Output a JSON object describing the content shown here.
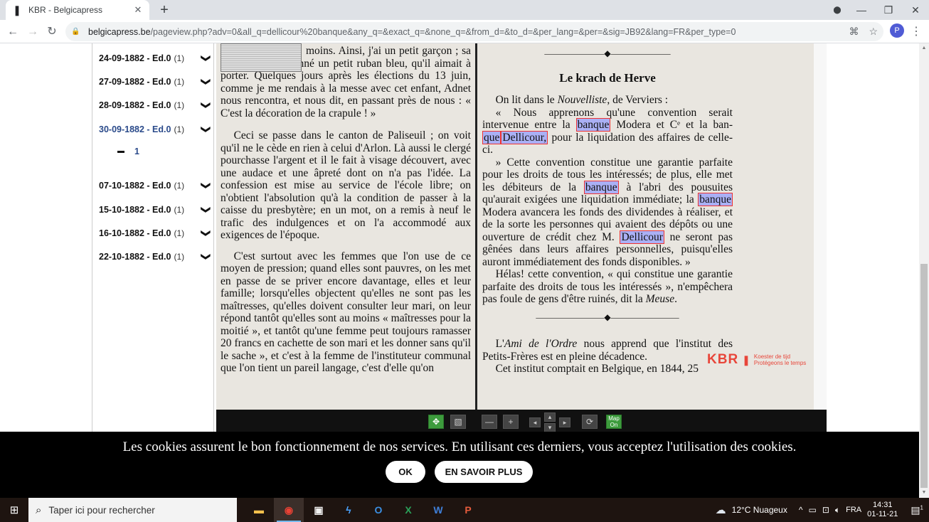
{
  "browser": {
    "tab_title": "KBR - Belgicapress",
    "url_host": "belgicapress.be",
    "url_path": "/pageview.php?adv=0&all_q=dellicour%20banque&any_q=&exact_q=&none_q=&from_d=&to_d=&per_lang=&per=&sig=JB92&lang=FR&per_type=0",
    "profile_initial": "P"
  },
  "sidebar": {
    "editions": [
      {
        "label": "24-09-1882 - Ed.0",
        "count": "(1)"
      },
      {
        "label": "27-09-1882 - Ed.0",
        "count": "(1)"
      },
      {
        "label": "28-09-1882 - Ed.0",
        "count": "(1)"
      },
      {
        "label": "30-09-1882 - Ed.0",
        "count": "(1)"
      },
      {
        "label": "07-10-1882 - Ed.0",
        "count": "(1)"
      },
      {
        "label": "15-10-1882 - Ed.0",
        "count": "(1)"
      },
      {
        "label": "16-10-1882 - Ed.0",
        "count": "(1)"
      },
      {
        "label": "22-10-1882 - Ed.0",
        "count": "(1)"
      }
    ],
    "active_page": "1"
  },
  "newspaper": {
    "left_lines_1": "moins. Ainsi, j'ai un petit garçon ; sa mère lui avait donné un petit ruban bleu, qu'il aimait à porter. Quelques jours après les élections du 13 juin, comme je me rendais à la messe avec cet enfant, Adnet nous rencontra, et nous dit, en passant près de nous : « C'est la décoration de la crapule ! »",
    "left_p2": "Ceci se passe dans le canton de Paliseuil ; on voit qu'il ne le cède en rien à celui d'Arlon. Là aussi le clergé pourchasse l'argent et il le fait à visage découvert, avec une audace et une âpreté dont on n'a pas l'idée. La confession est mise au service de l'école libre; on n'obtient l'absolution qu'à la condition de passer à la caisse du presbytère; en un mot, on a remis à neuf le trafic des indulgences et on l'a accommodé aux exigences de l'époque.",
    "left_p3": "C'est surtout avec les femmes que l'on use de ce moyen de pression; quand elles sont pauvres, on les met en passe de se priver encore davantage, elles et leur famille; lorsqu'elles objectent qu'elles ne sont pas les maîtresses, qu'elles doivent consulter leur mari, on leur répond tantôt qu'elles sont au moins « maîtresses pour la moitié », et tantôt qu'une femme peut toujours ramasser 20 francs en cachette de son mari et les donner sans qu'il le sache », et c'est à la femme de l'instituteur communal que l'on tient un pareil langage, c'est d'elle qu'on",
    "right_title": "Le krach de Herve",
    "right_p1_a": "On lit dans le",
    "right_p1_italic": "Nouvelliste",
    "right_p1_b": ", de Verviers :",
    "right_p2_a": "« Nous apprenons qu'une convention serait intervenue entre la",
    "hl_banque": "banque",
    "right_p2_b": "Modera et Cᵉ et la ban-",
    "hl_que": "que",
    "hl_dellicour_comma": "Dellicour,",
    "right_p2_c": "pour la liquidation des affaires de celle-ci.",
    "right_p3_a": "» Cette convention constitue une garantie parfaite pour les droits de tous les intéressés; de plus, elle met les débiteurs de la",
    "right_p3_b": "à l'abri des pousuites qu'aurait exigées une liquidation immédiate; la",
    "right_p3_c": "Modera avancera les fonds des dividendes à réaliser, et de la sorte les personnes qui avaient des dépôts ou une ouverture de crédit chez M.",
    "hl_dellicour": "Dellicour",
    "right_p3_d": "ne seront pas gênées dans leurs affaires personnelles, puisqu'elles auront immédiatement des fonds disponibles. »",
    "right_p4_a": "Hélas! cette convention, « qui constitue une garantie parfaite des droits de tous les intéressés », n'empêchera pas foule de gens d'être ruinés, dit la",
    "right_p4_italic": "Meuse",
    "right_p4_b": ".",
    "right_p5_a": "L'",
    "right_p5_italic": "Ami de l'Ordre",
    "right_p5_b": " nous apprend que l'institut des Petits-Frères est en pleine décadence.",
    "right_p6": "Cet institut comptait en Belgique, en 1844, 25",
    "watermark_name": "KBR",
    "watermark_tag1": "Koester de tijd",
    "watermark_tag2": "Protégeons le temps"
  },
  "viewer_toolbar": {
    "map_label_1": "Map",
    "map_label_2": "On"
  },
  "cookie": {
    "text": "Les cookies assurent le bon fonctionnement de nos services. En utilisant ces derniers, vous acceptez l'utilisation des cookies.",
    "ok": "OK",
    "more": "EN SAVOIR PLUS"
  },
  "taskbar": {
    "search_placeholder": "Taper ici pour rechercher",
    "weather": "12°C Nuageux",
    "lang": "FRA",
    "time": "14:31",
    "date": "01-11-21",
    "notif_count": "1"
  },
  "colors": {
    "highlight": "#aab0f5",
    "highlight_border": "#ee3333",
    "active_edition": "#2a4a8a",
    "kbr_red": "#e8463a"
  }
}
